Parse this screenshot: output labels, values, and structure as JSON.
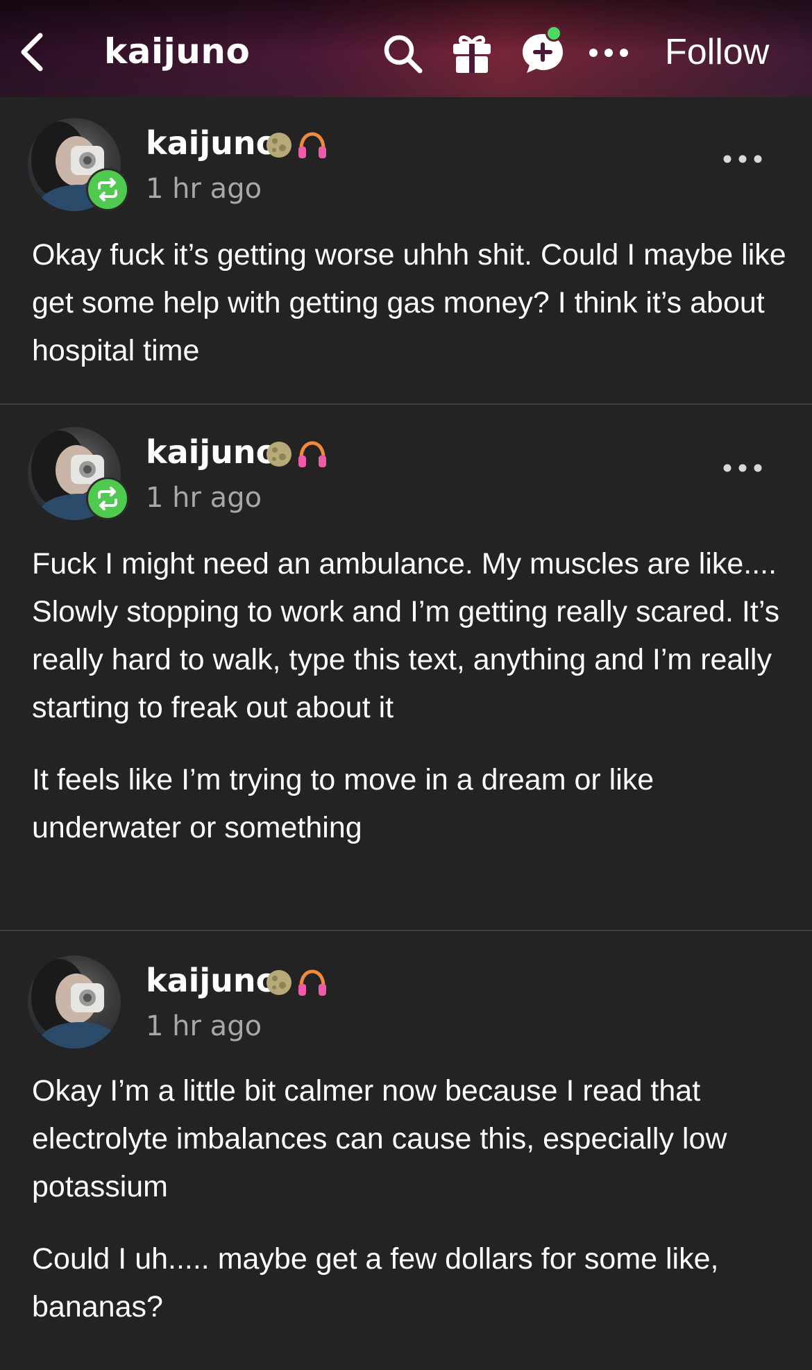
{
  "header": {
    "blog_name": "kaijuno",
    "follow_label": "Follow",
    "icons": [
      "back-arrow-icon",
      "search-icon",
      "gift-icon",
      "chat-icon",
      "more-icon"
    ],
    "notification_dot_color": "#4cd964"
  },
  "posts": [
    {
      "username": "kaijuno",
      "timestamp": "1 hr ago",
      "is_reblog": true,
      "badges": [
        "moon-icon",
        "headphones-icon"
      ],
      "paragraphs": [
        "Okay fuck it’s getting worse uhhh shit. Could I maybe like get some help with getting gas money? I think it’s about hospital time"
      ]
    },
    {
      "username": "kaijuno",
      "timestamp": "1 hr ago",
      "is_reblog": true,
      "badges": [
        "moon-icon",
        "headphones-icon"
      ],
      "paragraphs": [
        "Fuck I might need an ambulance. My muscles are like.... Slowly stopping to work and I’m getting really scared. It’s really hard to walk, type this text, anything and I’m really starting to freak out about it",
        "It feels like I’m trying to move in a dream or like underwater or something"
      ]
    },
    {
      "username": "kaijuno",
      "timestamp": "1 hr ago",
      "is_reblog": false,
      "badges": [
        "moon-icon",
        "headphones-icon"
      ],
      "paragraphs": [
        "Okay I’m a little bit calmer now because I read that electrolyte imbalances can cause this, especially low potassium",
        "Could I uh..... maybe get a few dollars for some like, bananas?"
      ]
    }
  ],
  "colors": {
    "background": "#232323",
    "reblog_badge": "#4fc94f",
    "timestamp": "#a8a8a8"
  }
}
